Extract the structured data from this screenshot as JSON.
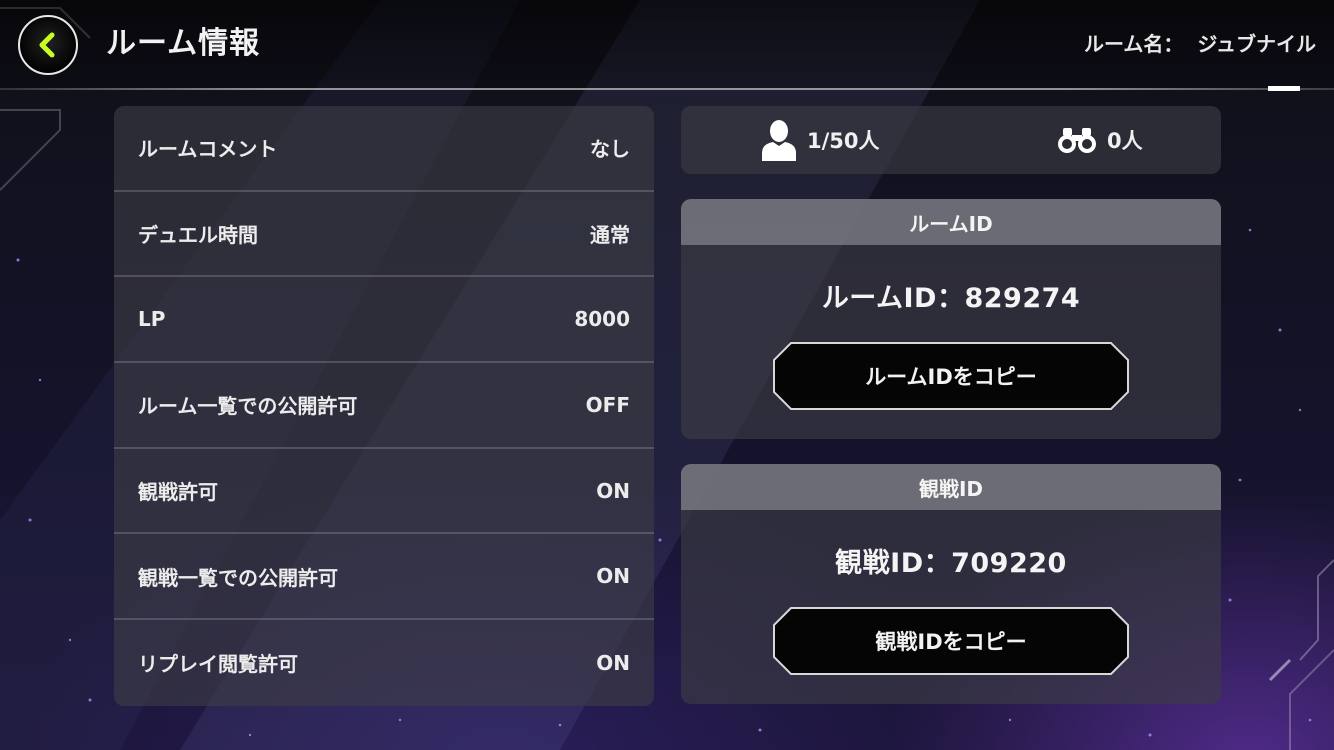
{
  "header": {
    "title": "ルーム情報",
    "room_name_label": "ルーム名：",
    "room_name_value": "ジュブナイル"
  },
  "settings": [
    {
      "label": "ルームコメント",
      "value": "なし"
    },
    {
      "label": "デュエル時間",
      "value": "通常"
    },
    {
      "label": "LP",
      "value": "8000"
    },
    {
      "label": "ルーム一覧での公開許可",
      "value": "OFF"
    },
    {
      "label": "観戦許可",
      "value": "ON"
    },
    {
      "label": "観戦一覧での公開許可",
      "value": "ON"
    },
    {
      "label": "リプレイ閲覧許可",
      "value": "ON"
    }
  ],
  "counts": {
    "players": "1/50人",
    "spectators": "0人",
    "player_icon": "person-icon",
    "spectator_icon": "binoculars-icon"
  },
  "room_id_box": {
    "header": "ルームID",
    "id_text": "ルームID：829274",
    "copy_label": "ルームIDをコピー"
  },
  "watch_id_box": {
    "header": "観戦ID",
    "id_text": "観戦ID：709220",
    "copy_label": "観戦IDをコピー"
  },
  "colors": {
    "back_arrow": "#c8ff1e",
    "panel": "#3e3e46",
    "accent_glow": "#7a3cc8"
  }
}
